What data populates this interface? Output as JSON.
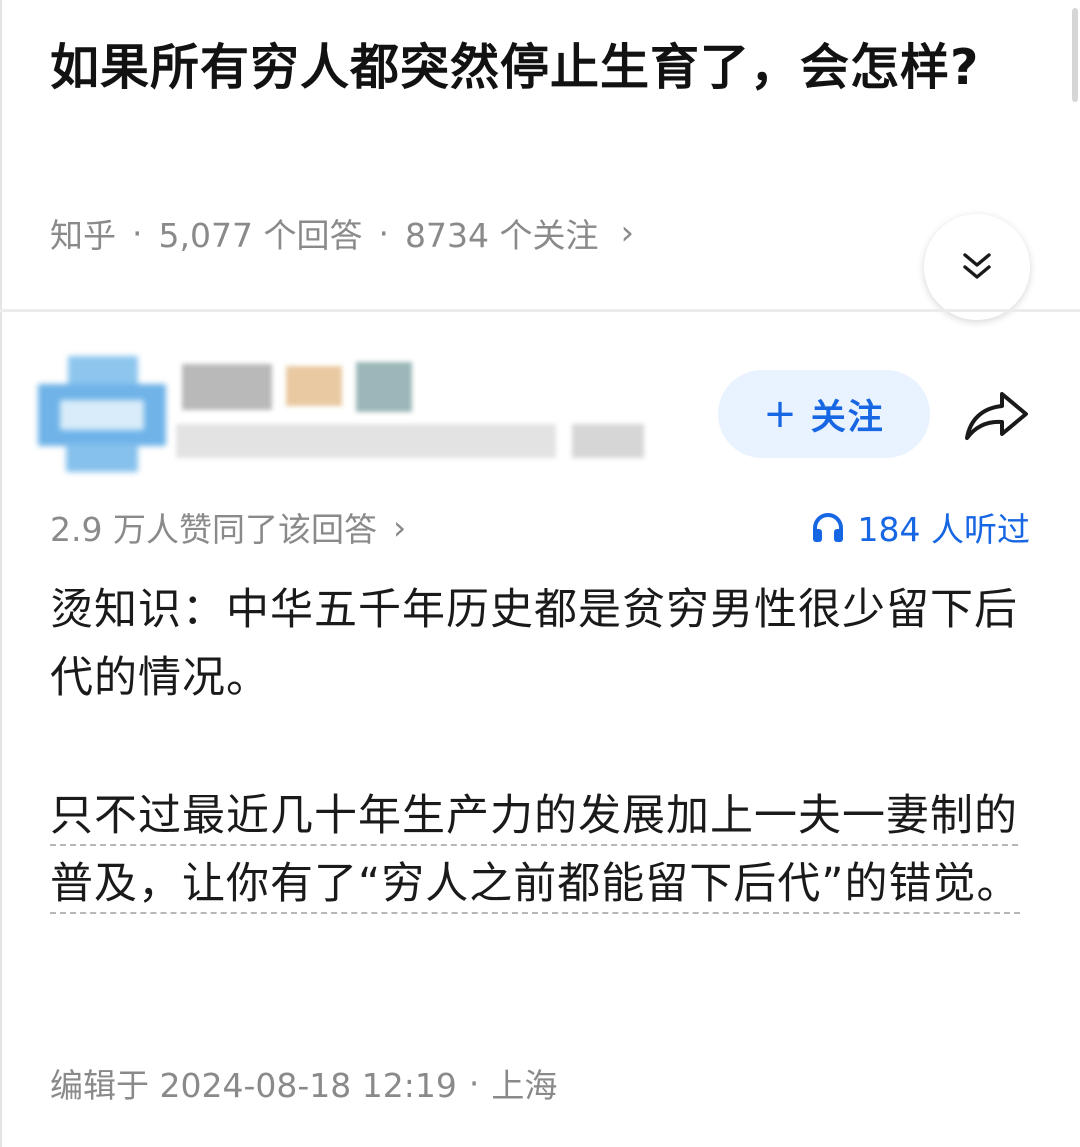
{
  "question": {
    "title": "如果所有穷人都突然停止生育了，会怎样?",
    "source": "知乎",
    "answers_count": "5,077 个回答",
    "followers_count": "8734 个关注",
    "separator": "·",
    "chevron": "›"
  },
  "author": {
    "follow_label": "关注",
    "follow_prefix": "+"
  },
  "answer": {
    "upvote_text": "2.9 万人赞同了该回答",
    "listen_text": "184 人听过",
    "paragraphs": [
      "烫知识：中华五千年历史都是贫穷男性很少留下后代的情况。",
      "只不过最近几十年生产力的发展加上一夫一妻制的普及，让你有了“穷人之前都能留下后代”的错觉。"
    ],
    "edit_time": "编辑于 2024-08-18 12:19",
    "location": "上海"
  },
  "icons": {
    "expand": "double-chevron-down-icon",
    "share": "share-arrow-icon",
    "listen": "headphones-icon"
  },
  "colors": {
    "accent": "#1766e3",
    "follow_bg": "#e9f2ff",
    "meta_text": "#8a8a8a"
  }
}
